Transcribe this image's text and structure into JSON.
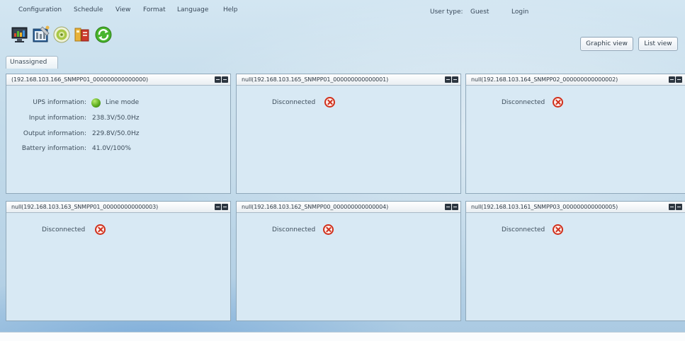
{
  "menu": {
    "items": [
      "Configuration",
      "Schedule",
      "View",
      "Format",
      "Language",
      "Help"
    ],
    "user_type_label": "User type:",
    "user_type_value": "Guest",
    "login": "Login"
  },
  "toolbar": {
    "icons": [
      "monitor-chart-icon",
      "settings-tools-icon",
      "power-disc-icon",
      "ups-battery-icon",
      "refresh-icon"
    ]
  },
  "view_buttons": {
    "graphic": "Graphic view",
    "list": "List view"
  },
  "tab": {
    "label": "Unassigned"
  },
  "panels": [
    {
      "title": "(192.168.103.166_SNMPP01_000000000000000)",
      "connected": true,
      "ups_label": "UPS information:",
      "ups_value": "Line mode",
      "input_label": "Input information:",
      "input_value": "238.3V/50.0Hz",
      "output_label": "Output information:",
      "output_value": "229.8V/50.0Hz",
      "battery_label": "Battery information:",
      "battery_value": "41.0V/100%"
    },
    {
      "title": "null(192.168.103.165_SNMPP01_000000000000001)",
      "status": "Disconnected"
    },
    {
      "title": "null(192.168.103.164_SNMPP02_000000000000002)",
      "status": "Disconnected"
    },
    {
      "title": "null(192.168.103.163_SNMPP01_000000000000003)",
      "status": "Disconnected"
    },
    {
      "title": "null(192.168.103.162_SNMPP00_000000000000004)",
      "status": "Disconnected"
    },
    {
      "title": "null(192.168.103.161_SNMPP03_000000000000005)",
      "status": "Disconnected"
    }
  ],
  "colors": {
    "panel_bg": "#d8e9f4",
    "status_ok": "#5fae21",
    "status_error": "#d0301c"
  }
}
